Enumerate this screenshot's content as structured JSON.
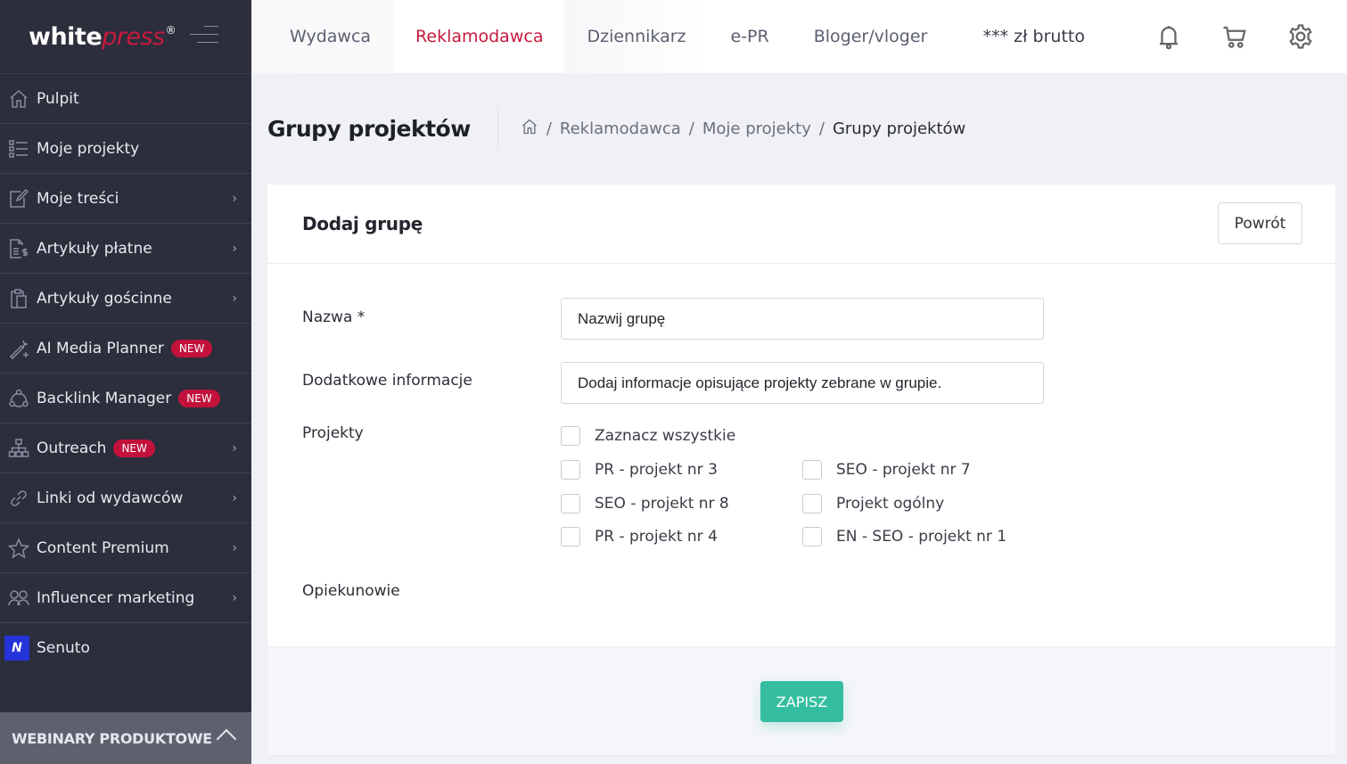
{
  "brand": {
    "logo_main": "white",
    "logo_accent": "press",
    "logo_reg": "®",
    "accent_color": "#c8193f"
  },
  "sidebar": {
    "items": [
      {
        "label": "Pulpit",
        "icon": "home-icon",
        "has_submenu": false
      },
      {
        "label": "Moje projekty",
        "icon": "list-icon",
        "has_submenu": false
      },
      {
        "label": "Moje treści",
        "icon": "edit-icon",
        "has_submenu": true
      },
      {
        "label": "Artykuły płatne",
        "icon": "paid-document-icon",
        "has_submenu": true
      },
      {
        "label": "Artykuły gościnne",
        "icon": "clipboard-icon",
        "has_submenu": true
      },
      {
        "label": "AI Media Planner",
        "icon": "magic-wand-icon",
        "badge": "NEW",
        "has_submenu": false
      },
      {
        "label": "Backlink Manager",
        "icon": "network-icon",
        "badge": "NEW",
        "has_submenu": false
      },
      {
        "label": "Outreach",
        "icon": "sitemap-icon",
        "badge": "NEW",
        "has_submenu": true
      },
      {
        "label": "Linki od wydawców",
        "icon": "link-icon",
        "has_submenu": true
      },
      {
        "label": "Content Premium",
        "icon": "star-icon",
        "has_submenu": true
      },
      {
        "label": "Influencer marketing",
        "icon": "users-icon",
        "has_submenu": true
      },
      {
        "label": "Senuto",
        "icon": "senuto-logo-icon",
        "icon_text": "N",
        "has_submenu": false
      }
    ],
    "chevron": "›",
    "footer_label": "WEBINARY PRODUKTOWE"
  },
  "topbar": {
    "tabs": [
      {
        "label": "Wydawca",
        "active": false
      },
      {
        "label": "Reklamodawca",
        "active": true
      },
      {
        "label": "Dziennikarz",
        "active": false
      },
      {
        "label": "e-PR",
        "active": false
      },
      {
        "label": "Bloger/vloger",
        "active": false
      }
    ],
    "balance": "*** zł brutto",
    "icons": [
      "bell-icon",
      "cart-icon",
      "gear-icon"
    ]
  },
  "page": {
    "title": "Grupy projektów",
    "breadcrumb": [
      "Reklamodawca",
      "Moje projekty",
      "Grupy projektów"
    ],
    "breadcrumb_sep": "/"
  },
  "card": {
    "title": "Dodaj grupę",
    "back_label": "Powrót",
    "fields": {
      "name_label": "Nazwa *",
      "name_value": "",
      "name_placeholder": "Nazwij grupę",
      "info_label": "Dodatkowe informacje",
      "info_value": "",
      "info_placeholder": "Dodaj informacje opisujące projekty zebrane w grupie.",
      "projects_label": "Projekty",
      "select_all_label": "Zaznacz wszystkie",
      "projects": [
        {
          "label": "PR - projekt nr 3",
          "checked": false
        },
        {
          "label": "SEO - projekt nr 7",
          "checked": false
        },
        {
          "label": "SEO - projekt nr 8",
          "checked": false
        },
        {
          "label": "Projekt ogólny",
          "checked": false
        },
        {
          "label": "PR - projekt nr 4",
          "checked": false
        },
        {
          "label": "EN - SEO - projekt nr 1",
          "checked": false
        }
      ],
      "guardians_label": "Opiekunowie"
    },
    "save_label": "ZAPISZ",
    "save_color": "#34be9f"
  }
}
